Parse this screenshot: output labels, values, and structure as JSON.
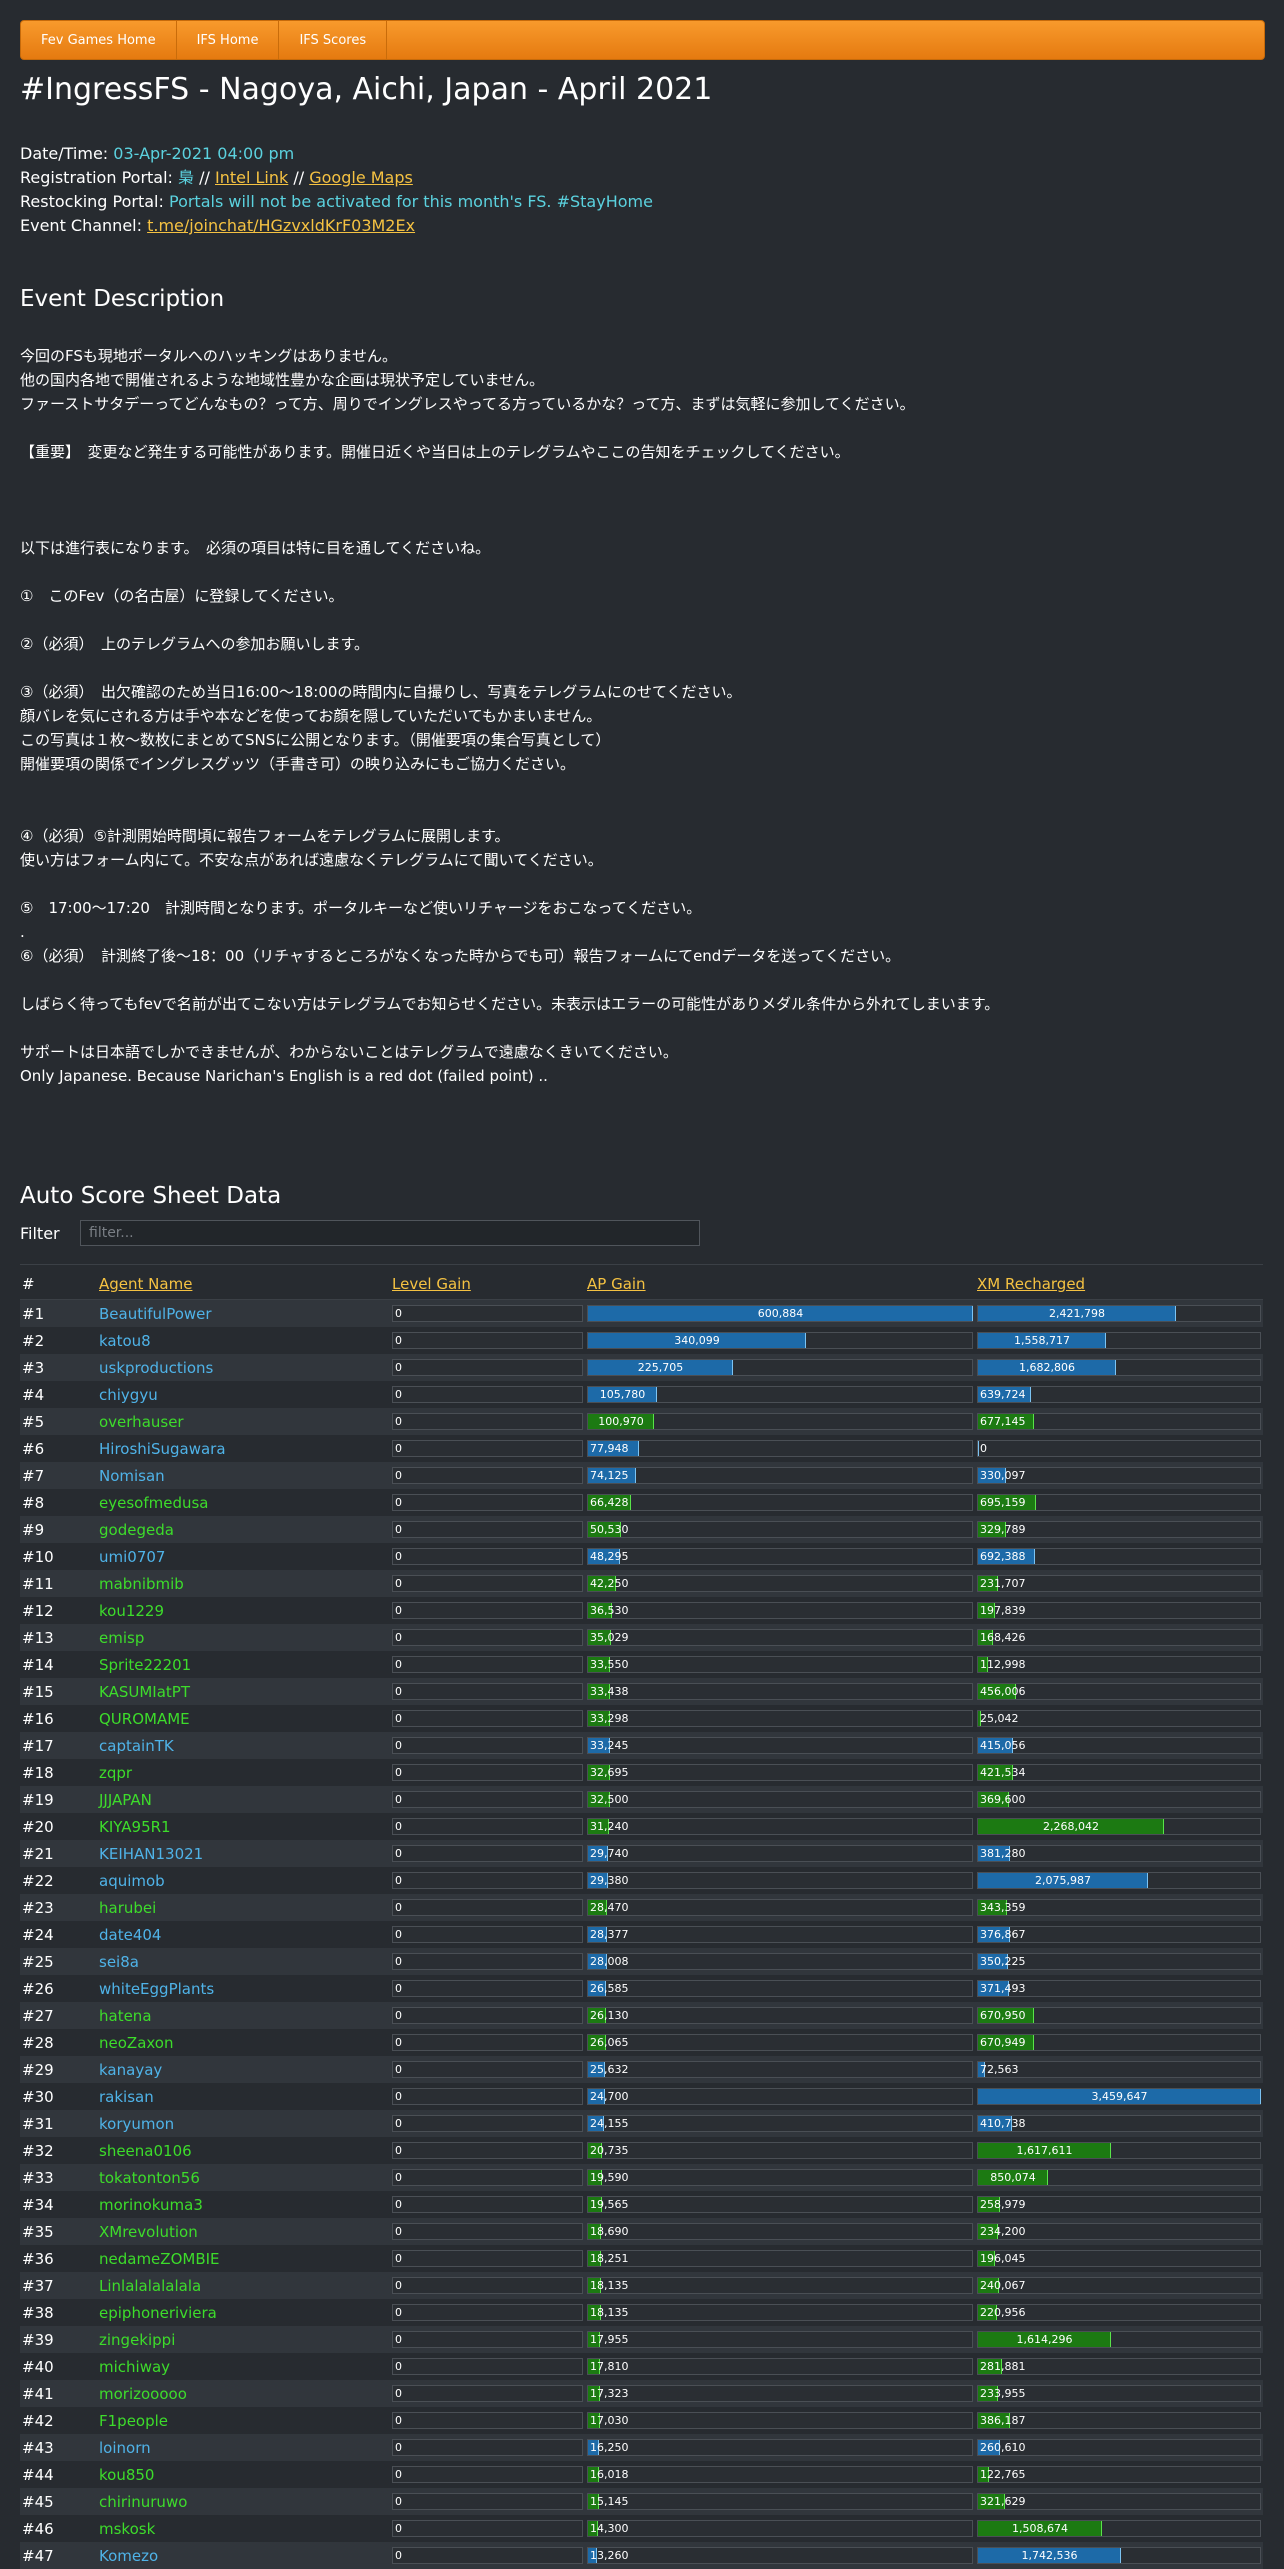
{
  "nav": [
    "Fev Games Home",
    "IFS Home",
    "IFS Scores"
  ],
  "title": "#IngressFS - Nagoya, Aichi, Japan - April 2021",
  "info": {
    "datetime_label": "Date/Time:",
    "datetime_value": "03-Apr-2021 04:00 pm",
    "registration_label": "Registration Portal:",
    "registration_portal": "梟",
    "sep": " // ",
    "intel_link": "Intel Link",
    "maps_link": "Google Maps",
    "restocking_label": "Restocking Portal:",
    "restocking_value": "Portals will not be activated for this month's FS. #StayHome",
    "channel_label": "Event Channel:",
    "channel_link": "t.me/joinchat/HGzvxldKrF03M2Ex"
  },
  "event_description_heading": "Event Description",
  "description": "今回のFSも現地ポータルへのハッキングはありません。\n他の国内各地で開催されるような地域性豊かな企画は現状予定していません。\nファーストサタデーってどんなもの？って方、周りでイングレスやってる方っているかな？って方、まずは気軽に参加してください。\n\n【重要】　変更など発生する可能性があります。開催日近くや当日は上のテレグラムやここの告知をチェックしてください。\n\n\n\n以下は進行表になります。　必須の項目は特に目を通してくださいね。\n\n①　このFev（の名古屋）に登録してください。\n\n②（必須）　上のテレグラムへの参加お願いします。\n\n③（必須）　出欠確認のため当日16:00～18:00の時間内に自撮りし、写真をテレグラムにのせてください。\n顔バレを気にされる方は手や本などを使ってお顔を隠していただいてもかまいません。\nこの写真は１枚～数枚にまとめてSNSに公開となります。（開催要項の集合写真として）\n開催要項の関係でイングレスグッツ（手書き可）の映り込みにもご協力ください。\n\n\n④（必須）⑤計測開始時間頃に報告フォームをテレグラムに展開します。\n使い方はフォーム内にて。不安な点があれば遠慮なくテレグラムにて聞いてください。\n\n⑤　17:00～17:20　計測時間となります。ポータルキーなど使いリチャージをおこなってください。\n.\n⑥（必須）　計測終了後～18：00（リチャするところがなくなった時からでも可）報告フォームにてendデータを送ってください。\n\nしばらく待ってもfevで名前が出てこない方はテレグラムでお知らせください。未表示はエラーの可能性がありメダル条件から外れてしまいます。\n\nサポートは日本語でしかできませんが、わからないことはテレグラムで遠慮なくきいてください。\nOnly Japanese. Because Narichan's English is a red dot (failed point) ..",
  "auto_score_heading": "Auto Score Sheet Data",
  "filter": {
    "label": "Filter",
    "placeholder": "filter..."
  },
  "table": {
    "headers": [
      "#",
      "Agent Name",
      "Level Gain",
      "AP Gain",
      "XM Recharged"
    ],
    "ap_max": 600884,
    "xm_max": 3459647,
    "rows": [
      {
        "rank": "#1",
        "name": "BeautifulPower",
        "faction": "blue",
        "level": "0",
        "ap": 600884,
        "ap_text": "600,884",
        "xm": 2421798,
        "xm_text": "2,421,798"
      },
      {
        "rank": "#2",
        "name": "katou8",
        "faction": "blue",
        "level": "0",
        "ap": 340099,
        "ap_text": "340,099",
        "xm": 1558717,
        "xm_text": "1,558,717"
      },
      {
        "rank": "#3",
        "name": "uskproductions",
        "faction": "blue",
        "level": "0",
        "ap": 225705,
        "ap_text": "225,705",
        "xm": 1682806,
        "xm_text": "1,682,806"
      },
      {
        "rank": "#4",
        "name": "chiygyu",
        "faction": "blue",
        "level": "0",
        "ap": 105780,
        "ap_text": "105,780",
        "xm": 639724,
        "xm_text": "639,724"
      },
      {
        "rank": "#5",
        "name": "overhauser",
        "faction": "green",
        "level": "0",
        "ap": 100970,
        "ap_text": "100,970",
        "xm": 677145,
        "xm_text": "677,145"
      },
      {
        "rank": "#6",
        "name": "HiroshiSugawara",
        "faction": "blue",
        "level": "0",
        "ap": 77948,
        "ap_text": "77,948",
        "xm": 0,
        "xm_text": "0"
      },
      {
        "rank": "#7",
        "name": "Nomisan",
        "faction": "blue",
        "level": "0",
        "ap": 74125,
        "ap_text": "74,125",
        "xm": 330097,
        "xm_text": "330,097"
      },
      {
        "rank": "#8",
        "name": "eyesofmedusa",
        "faction": "green",
        "level": "0",
        "ap": 66428,
        "ap_text": "66,428",
        "xm": 695159,
        "xm_text": "695,159"
      },
      {
        "rank": "#9",
        "name": "godegeda",
        "faction": "green",
        "level": "0",
        "ap": 50530,
        "ap_text": "50,530",
        "xm": 329789,
        "xm_text": "329,789"
      },
      {
        "rank": "#10",
        "name": "umi0707",
        "faction": "blue",
        "level": "0",
        "ap": 48295,
        "ap_text": "48,295",
        "xm": 692388,
        "xm_text": "692,388"
      },
      {
        "rank": "#11",
        "name": "mabnibmib",
        "faction": "green",
        "level": "0",
        "ap": 42250,
        "ap_text": "42,250",
        "xm": 231707,
        "xm_text": "231,707"
      },
      {
        "rank": "#12",
        "name": "kou1229",
        "faction": "green",
        "level": "0",
        "ap": 36530,
        "ap_text": "36,530",
        "xm": 197839,
        "xm_text": "197,839"
      },
      {
        "rank": "#13",
        "name": "emisp",
        "faction": "green",
        "level": "0",
        "ap": 35029,
        "ap_text": "35,029",
        "xm": 168426,
        "xm_text": "168,426"
      },
      {
        "rank": "#14",
        "name": "Sprite22201",
        "faction": "green",
        "level": "0",
        "ap": 33550,
        "ap_text": "33,550",
        "xm": 112998,
        "xm_text": "112,998"
      },
      {
        "rank": "#15",
        "name": "KASUMIatPT",
        "faction": "green",
        "level": "0",
        "ap": 33438,
        "ap_text": "33,438",
        "xm": 456006,
        "xm_text": "456,006"
      },
      {
        "rank": "#16",
        "name": "QUROMAME",
        "faction": "green",
        "level": "0",
        "ap": 33298,
        "ap_text": "33,298",
        "xm": 25042,
        "xm_text": "25,042"
      },
      {
        "rank": "#17",
        "name": "captainTK",
        "faction": "blue",
        "level": "0",
        "ap": 33245,
        "ap_text": "33,245",
        "xm": 415056,
        "xm_text": "415,056"
      },
      {
        "rank": "#18",
        "name": "zqpr",
        "faction": "green",
        "level": "0",
        "ap": 32695,
        "ap_text": "32,695",
        "xm": 421534,
        "xm_text": "421,534"
      },
      {
        "rank": "#19",
        "name": "JJJAPAN",
        "faction": "green",
        "level": "0",
        "ap": 32500,
        "ap_text": "32,500",
        "xm": 369600,
        "xm_text": "369,600"
      },
      {
        "rank": "#20",
        "name": "KIYA95R1",
        "faction": "green",
        "level": "0",
        "ap": 31240,
        "ap_text": "31,240",
        "xm": 2268042,
        "xm_text": "2,268,042"
      },
      {
        "rank": "#21",
        "name": "KEIHAN13021",
        "faction": "blue",
        "level": "0",
        "ap": 29740,
        "ap_text": "29,740",
        "xm": 381280,
        "xm_text": "381,280"
      },
      {
        "rank": "#22",
        "name": "aquimob",
        "faction": "blue",
        "level": "0",
        "ap": 29380,
        "ap_text": "29,380",
        "xm": 2075987,
        "xm_text": "2,075,987"
      },
      {
        "rank": "#23",
        "name": "harubei",
        "faction": "green",
        "level": "0",
        "ap": 28470,
        "ap_text": "28,470",
        "xm": 343359,
        "xm_text": "343,359"
      },
      {
        "rank": "#24",
        "name": "date404",
        "faction": "blue",
        "level": "0",
        "ap": 28377,
        "ap_text": "28,377",
        "xm": 376867,
        "xm_text": "376,867"
      },
      {
        "rank": "#25",
        "name": "sei8a",
        "faction": "blue",
        "level": "0",
        "ap": 28008,
        "ap_text": "28,008",
        "xm": 350225,
        "xm_text": "350,225"
      },
      {
        "rank": "#26",
        "name": "whiteEggPlants",
        "faction": "blue",
        "level": "0",
        "ap": 26585,
        "ap_text": "26,585",
        "xm": 371493,
        "xm_text": "371,493"
      },
      {
        "rank": "#27",
        "name": "hatena",
        "faction": "green",
        "level": "0",
        "ap": 26130,
        "ap_text": "26,130",
        "xm": 670950,
        "xm_text": "670,950"
      },
      {
        "rank": "#28",
        "name": "neoZaxon",
        "faction": "green",
        "level": "0",
        "ap": 26065,
        "ap_text": "26,065",
        "xm": 670949,
        "xm_text": "670,949"
      },
      {
        "rank": "#29",
        "name": "kanayay",
        "faction": "blue",
        "level": "0",
        "ap": 25632,
        "ap_text": "25,632",
        "xm": 72563,
        "xm_text": "72,563"
      },
      {
        "rank": "#30",
        "name": "rakisan",
        "faction": "blue",
        "level": "0",
        "ap": 24700,
        "ap_text": "24,700",
        "xm": 3459647,
        "xm_text": "3,459,647"
      },
      {
        "rank": "#31",
        "name": "koryumon",
        "faction": "blue",
        "level": "0",
        "ap": 24155,
        "ap_text": "24,155",
        "xm": 410738,
        "xm_text": "410,738"
      },
      {
        "rank": "#32",
        "name": "sheena0106",
        "faction": "green",
        "level": "0",
        "ap": 20735,
        "ap_text": "20,735",
        "xm": 1617611,
        "xm_text": "1,617,611"
      },
      {
        "rank": "#33",
        "name": "tokatonton56",
        "faction": "green",
        "level": "0",
        "ap": 19590,
        "ap_text": "19,590",
        "xm": 850074,
        "xm_text": "850,074"
      },
      {
        "rank": "#34",
        "name": "morinokuma3",
        "faction": "green",
        "level": "0",
        "ap": 19565,
        "ap_text": "19,565",
        "xm": 258979,
        "xm_text": "258,979"
      },
      {
        "rank": "#35",
        "name": "XMrevolution",
        "faction": "green",
        "level": "0",
        "ap": 18690,
        "ap_text": "18,690",
        "xm": 234200,
        "xm_text": "234,200"
      },
      {
        "rank": "#36",
        "name": "nedameZOMBIE",
        "faction": "green",
        "level": "0",
        "ap": 18251,
        "ap_text": "18,251",
        "xm": 196045,
        "xm_text": "196,045"
      },
      {
        "rank": "#37",
        "name": "Linlalalalalala",
        "faction": "green",
        "level": "0",
        "ap": 18135,
        "ap_text": "18,135",
        "xm": 240067,
        "xm_text": "240,067"
      },
      {
        "rank": "#38",
        "name": "epiphoneriviera",
        "faction": "green",
        "level": "0",
        "ap": 18135,
        "ap_text": "18,135",
        "xm": 220956,
        "xm_text": "220,956"
      },
      {
        "rank": "#39",
        "name": "zingekippi",
        "faction": "green",
        "level": "0",
        "ap": 17955,
        "ap_text": "17,955",
        "xm": 1614296,
        "xm_text": "1,614,296"
      },
      {
        "rank": "#40",
        "name": "michiway",
        "faction": "green",
        "level": "0",
        "ap": 17810,
        "ap_text": "17,810",
        "xm": 281881,
        "xm_text": "281,881"
      },
      {
        "rank": "#41",
        "name": "morizooooo",
        "faction": "green",
        "level": "0",
        "ap": 17323,
        "ap_text": "17,323",
        "xm": 233955,
        "xm_text": "233,955"
      },
      {
        "rank": "#42",
        "name": "F1people",
        "faction": "green",
        "level": "0",
        "ap": 17030,
        "ap_text": "17,030",
        "xm": 386187,
        "xm_text": "386,187"
      },
      {
        "rank": "#43",
        "name": "loinorn",
        "faction": "blue",
        "level": "0",
        "ap": 16250,
        "ap_text": "16,250",
        "xm": 260610,
        "xm_text": "260,610"
      },
      {
        "rank": "#44",
        "name": "kou850",
        "faction": "green",
        "level": "0",
        "ap": 16018,
        "ap_text": "16,018",
        "xm": 122765,
        "xm_text": "122,765"
      },
      {
        "rank": "#45",
        "name": "chirinuruwo",
        "faction": "green",
        "level": "0",
        "ap": 15145,
        "ap_text": "15,145",
        "xm": 321629,
        "xm_text": "321,629"
      },
      {
        "rank": "#46",
        "name": "mskosk",
        "faction": "green",
        "level": "0",
        "ap": 14300,
        "ap_text": "14,300",
        "xm": 1508674,
        "xm_text": "1,508,674"
      },
      {
        "rank": "#47",
        "name": "Komezo",
        "faction": "blue",
        "level": "0",
        "ap": 13260,
        "ap_text": "13,260",
        "xm": 1742536,
        "xm_text": "1,742,536"
      }
    ]
  }
}
